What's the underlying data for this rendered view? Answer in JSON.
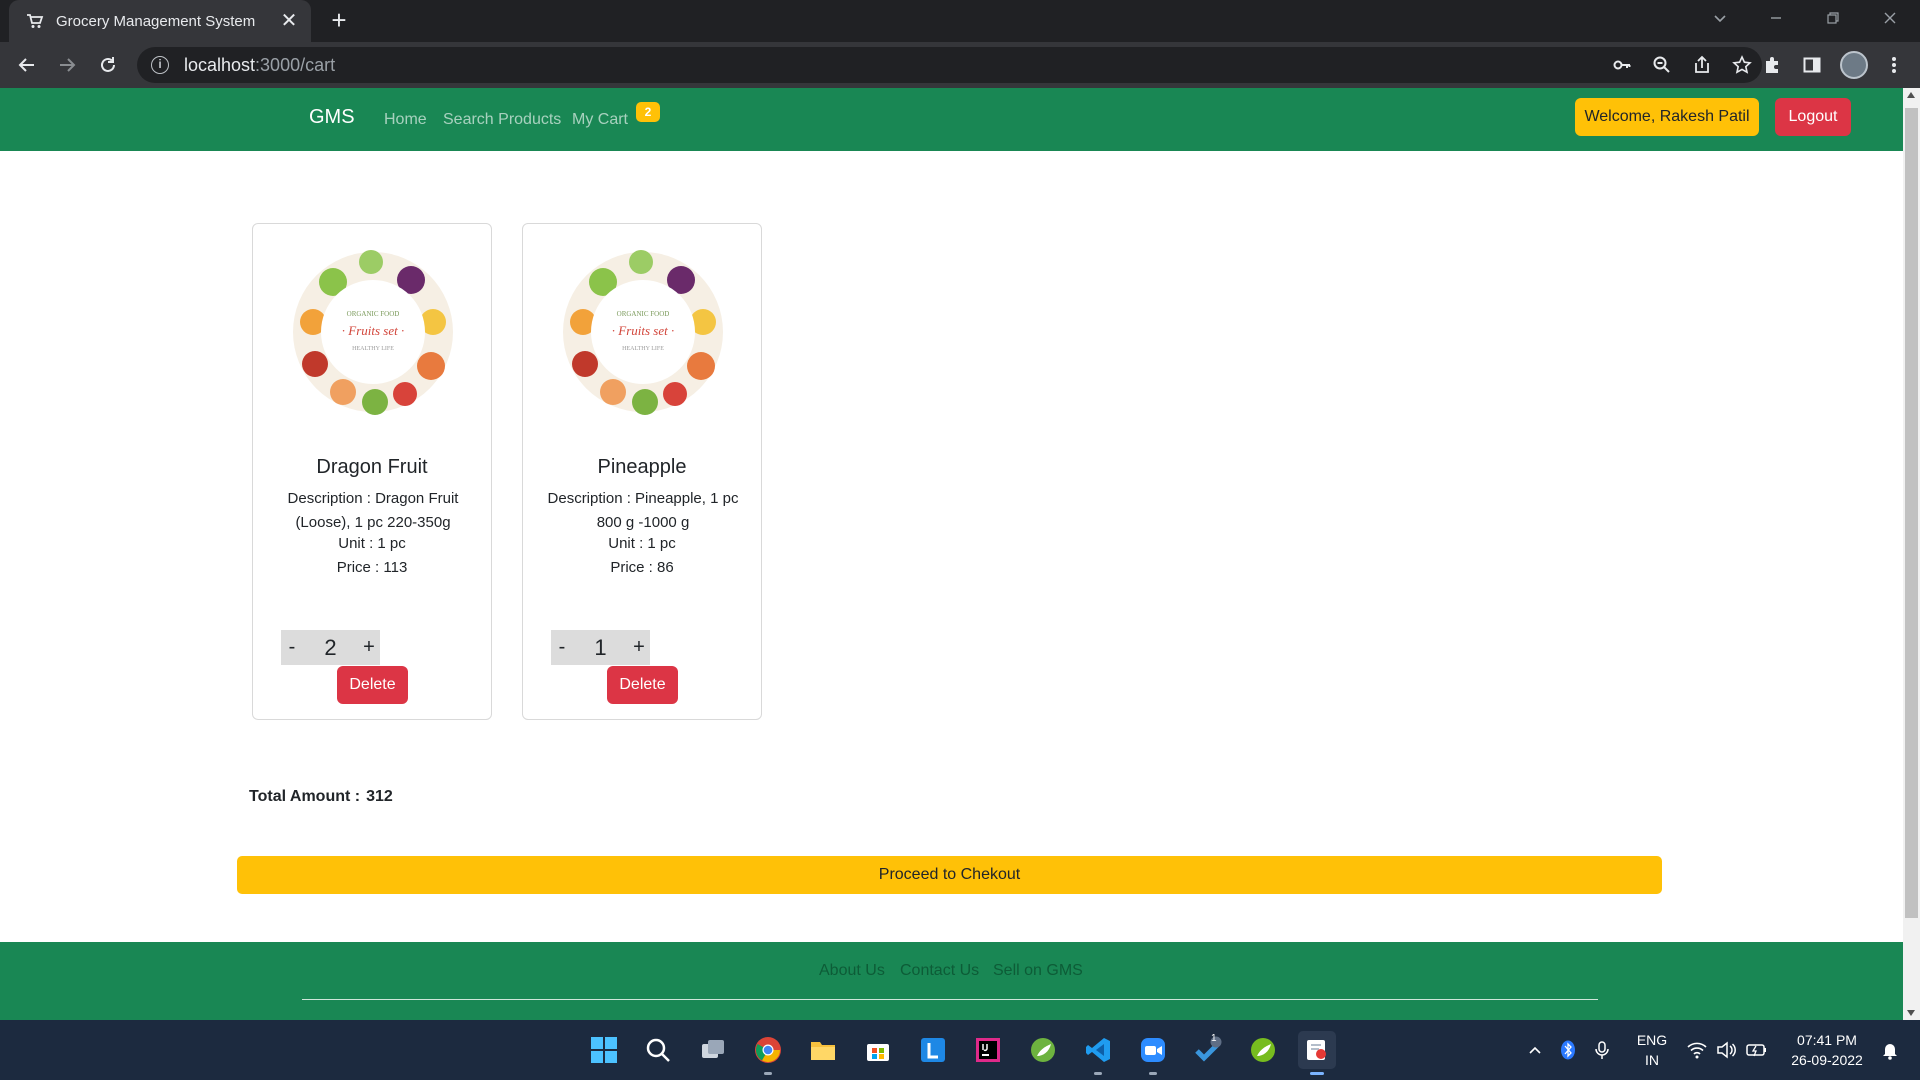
{
  "browser": {
    "tab_title": "Grocery Management System",
    "tab_close": "✕",
    "new_tab": "+",
    "url_host": "localhost",
    "url_path": ":3000/cart"
  },
  "navbar": {
    "brand": "GMS",
    "links": [
      "Home",
      "Search Products",
      "My Cart"
    ],
    "cart_count": "2",
    "welcome": "Welcome, Rakesh Patil",
    "logout": "Logout"
  },
  "cart": {
    "items": [
      {
        "image_text": {
          "line1": "ORGANIC FOOD",
          "line2": "· Fruits set ·",
          "line3": "HEALTHY LIFE"
        },
        "name": "Dragon Fruit",
        "description": "Description : Dragon Fruit (Loose), 1 pc 220-350g",
        "unit": "Unit : 1 pc",
        "price": "Price : 113",
        "quantity": "2",
        "minus": "-",
        "plus": "+",
        "delete": "Delete"
      },
      {
        "image_text": {
          "line1": "ORGANIC FOOD",
          "line2": "· Fruits set ·",
          "line3": "HEALTHY LIFE"
        },
        "name": "Pineapple",
        "description": "Description : Pineapple, 1 pc 800 g -1000 g",
        "unit": "Unit : 1 pc",
        "price": "Price : 86",
        "quantity": "1",
        "minus": "-",
        "plus": "+",
        "delete": "Delete"
      }
    ],
    "total_label": "Total Amount :",
    "total_value": "312",
    "checkout": "Proceed to Chekout"
  },
  "footer": {
    "links": [
      "About Us",
      "Contact Us",
      "Sell on GMS"
    ]
  },
  "taskbar": {
    "lang_top": "ENG",
    "lang_bottom": "IN",
    "time": "07:41 PM",
    "date": "26-09-2022",
    "badge": "1"
  },
  "colors": {
    "navbar": "#198754",
    "warning": "#ffc107",
    "danger": "#dc3545",
    "taskbar": "#1c2a3f"
  }
}
